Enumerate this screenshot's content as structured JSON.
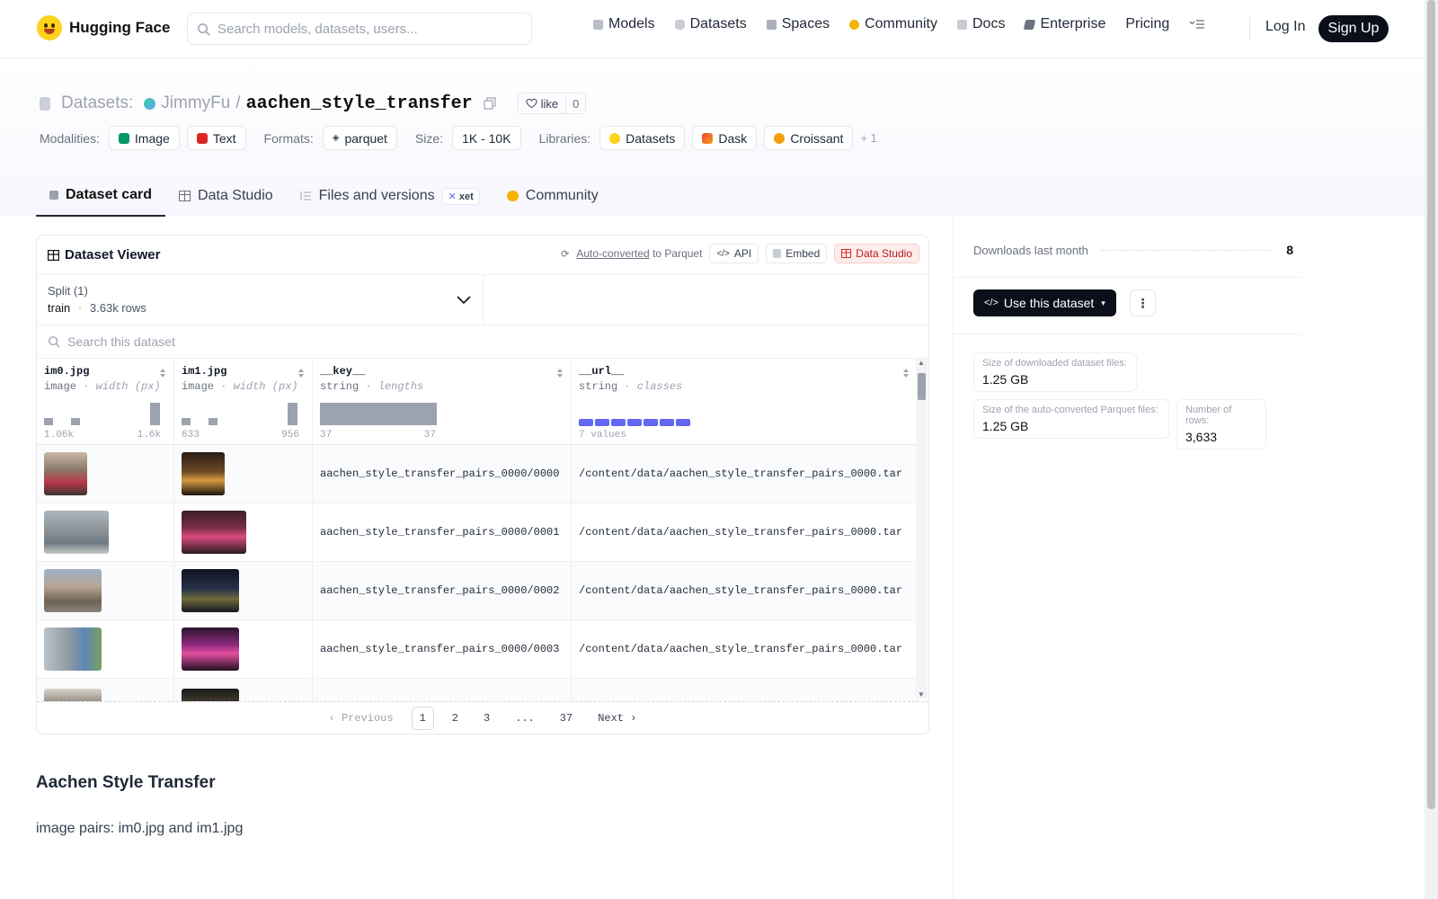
{
  "header": {
    "logo_text": "Hugging Face",
    "search_placeholder": "Search models, datasets, users...",
    "nav": [
      {
        "label": "Models",
        "icon": "models-icon",
        "color": "#9ca3af"
      },
      {
        "label": "Datasets",
        "icon": "datasets-icon",
        "color": "#b9bec8"
      },
      {
        "label": "Spaces",
        "icon": "spaces-icon",
        "color": "#9ca3af"
      },
      {
        "label": "Community",
        "icon": "community-icon",
        "color": "#f4b400"
      },
      {
        "label": "Docs",
        "icon": "docs-icon",
        "color": "#9ca3af"
      },
      {
        "label": "Enterprise",
        "icon": "enterprise-icon",
        "color": "#6b7280"
      },
      {
        "label": "Pricing",
        "icon": "",
        "color": ""
      }
    ],
    "login": "Log In",
    "signup": "Sign Up"
  },
  "repo": {
    "type_label": "Datasets:",
    "owner": "JimmyFu",
    "separator": "/",
    "name": "aachen_style_transfer",
    "like_label": "like",
    "like_count": "0"
  },
  "meta": {
    "modalities_label": "Modalities:",
    "modalities": [
      "Image",
      "Text"
    ],
    "formats_label": "Formats:",
    "formats": [
      "parquet"
    ],
    "size_label": "Size:",
    "size": "1K - 10K",
    "libraries_label": "Libraries:",
    "libraries": [
      "Datasets",
      "Dask",
      "Croissant"
    ],
    "more": "+ 1"
  },
  "tabs": [
    {
      "label": "Dataset card",
      "active": true
    },
    {
      "label": "Data Studio",
      "active": false
    },
    {
      "label": "Files and versions",
      "active": false,
      "badge": "xet"
    },
    {
      "label": "Community",
      "active": false
    }
  ],
  "viewer": {
    "title": "Dataset Viewer",
    "auto_converted": "Auto-converted",
    "to_parquet": "to Parquet",
    "api": "API",
    "embed": "Embed",
    "data_studio": "Data Studio",
    "split_label": "Split (1)",
    "split_name": "train",
    "split_dot": "·",
    "split_rows": "3.63k rows",
    "search_placeholder": "Search this dataset",
    "columns": [
      {
        "name": "im0.jpg",
        "type": "image",
        "stat": "· width (px)",
        "min": "1.06k",
        "max": "1.6k"
      },
      {
        "name": "im1.jpg",
        "type": "image",
        "stat": "· width (px)",
        "min": "633",
        "max": "956"
      },
      {
        "name": "__key__",
        "type": "string",
        "stat": "· lengths",
        "min": "37",
        "max": "37"
      },
      {
        "name": "__url__",
        "type": "string",
        "stat": "· classes",
        "min": "7 values",
        "max": ""
      }
    ],
    "rows": [
      {
        "key": "aachen_style_transfer_pairs_0000/0000",
        "url": "/content/data/aachen_style_transfer_pairs_0000.tar"
      },
      {
        "key": "aachen_style_transfer_pairs_0000/0001",
        "url": "/content/data/aachen_style_transfer_pairs_0000.tar"
      },
      {
        "key": "aachen_style_transfer_pairs_0000/0002",
        "url": "/content/data/aachen_style_transfer_pairs_0000.tar"
      },
      {
        "key": "aachen_style_transfer_pairs_0000/0003",
        "url": "/content/data/aachen_style_transfer_pairs_0000.tar"
      },
      {
        "key": "",
        "url": ""
      }
    ],
    "pager": {
      "previous": "Previous",
      "pages": [
        "1",
        "2",
        "3",
        "...",
        "37"
      ],
      "current": "1",
      "next": "Next"
    }
  },
  "readme": {
    "title": "Aachen Style Transfer",
    "body": "image pairs: im0.jpg and im1.jpg"
  },
  "sidebar": {
    "downloads_label": "Downloads last month",
    "downloads": "8",
    "use_button": "Use this dataset",
    "stats": [
      {
        "label": "Size of downloaded dataset files:",
        "value": "1.25 GB"
      },
      {
        "label": "Size of the auto-converted Parquet files:",
        "value": "1.25 GB"
      },
      {
        "label": "Number of rows:",
        "value": "3,633"
      }
    ]
  },
  "colors": {
    "accent_dark": "#0b0f1a",
    "url_classes_bar": "#6366f1",
    "hist_bar": "#9ca3af"
  }
}
